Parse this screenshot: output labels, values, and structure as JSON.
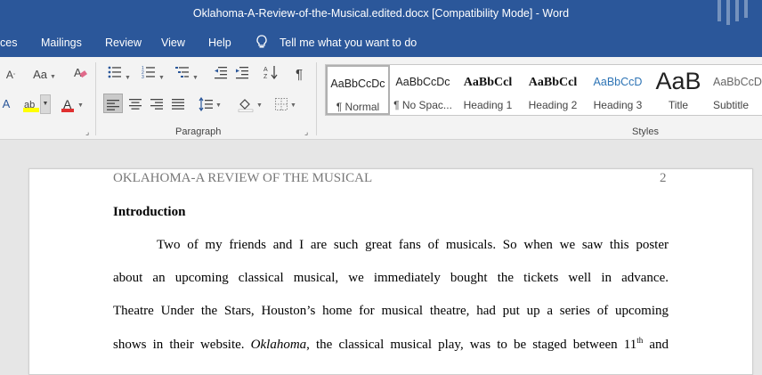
{
  "titlebar": {
    "title": "Oklahoma-A-Review-of-the-Musical.edited.docx [Compatibility Mode]  -  Word"
  },
  "tabs": {
    "references": "ces",
    "mailings": "Mailings",
    "review": "Review",
    "view": "View",
    "help": "Help",
    "tell_me": "Tell me what you want to do"
  },
  "ribbon": {
    "font_case_label": "Aa",
    "paragraph_group": "Paragraph",
    "styles_group": "Styles",
    "pilcrow": "¶",
    "styles": [
      {
        "preview": "AaBbCcDc",
        "name": "¶ Normal"
      },
      {
        "preview": "AaBbCcDc",
        "name": "¶ No Spac..."
      },
      {
        "preview": "AaBbCcl",
        "name": "Heading 1"
      },
      {
        "preview": "AaBbCcl",
        "name": "Heading 2"
      },
      {
        "preview": "AaBbCcD",
        "name": "Heading 3"
      },
      {
        "preview": "AaB",
        "name": "Title"
      },
      {
        "preview": "AaBbCcD",
        "name": "Subtitle"
      }
    ],
    "colors": {
      "highlight": "#ffff00",
      "font_color": "#e03030",
      "accent": "#2b579a",
      "heading_blue": "#2e74b5"
    }
  },
  "document": {
    "header": "OKLAHOMA-A REVIEW OF THE MUSICAL",
    "page_number": "2",
    "heading": "Introduction",
    "lines": [
      "Two of my friends and I are such great fans of musicals. So when we saw this poster",
      "about an upcoming classical musical, we immediately bought the tickets well in advance.",
      "Theatre Under the Stars, Houston’s home for musical theatre, had put up a series of upcoming"
    ],
    "last_line": {
      "before": "shows in their website. ",
      "italic": "Oklahoma",
      "after": ", the classical musical play, was to be staged between 11",
      "sup": "th",
      "end": " and"
    }
  }
}
